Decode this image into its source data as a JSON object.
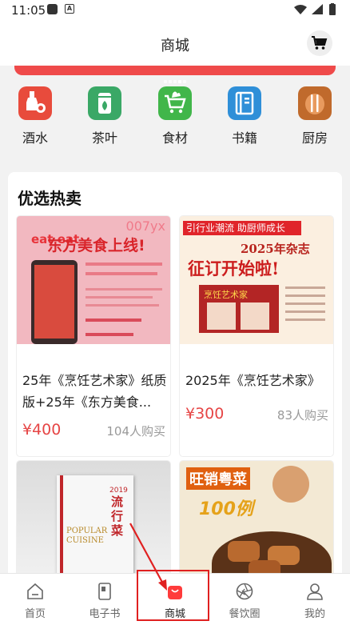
{
  "status_bar": {
    "time": "11:05",
    "notif_icon_letter": "A"
  },
  "header": {
    "title": "商城"
  },
  "categories": [
    {
      "label": "酒水",
      "icon": "wine-icon",
      "color": "#e84b3c"
    },
    {
      "label": "茶叶",
      "icon": "tea-icon",
      "color": "#3aa866"
    },
    {
      "label": "食材",
      "icon": "grocery-cart-icon",
      "color": "#41b64a"
    },
    {
      "label": "书籍",
      "icon": "book-icon",
      "color": "#2f8fd8"
    },
    {
      "label": "厨房",
      "icon": "kitchen-utensils-icon",
      "color": "#c06a2c"
    }
  ],
  "section": {
    "title": "优选热卖"
  },
  "products": [
    {
      "name": "25年《烹饪艺术家》纸质版+25年《东方美食...",
      "price": "¥400",
      "sold": "104人购买",
      "image": {
        "brand": "eat eat",
        "headline": "东方美食上线!",
        "tag": "007yx"
      }
    },
    {
      "name": "2025年《烹饪艺术家》",
      "price": "¥300",
      "sold": "83人购买",
      "image": {
        "top": "引行业潮流 助厨师成长",
        "year": "2025年杂志",
        "headline": "征订开始啦!",
        "magazine": "烹饪艺术家"
      }
    },
    {
      "image": {
        "headline": "流行菜",
        "subtitle": "POPULAR CUISINE",
        "year": "2019"
      }
    },
    {
      "image": {
        "headline": "旺销粤菜",
        "subtitle": "100例"
      }
    }
  ],
  "tabbar": [
    {
      "label": "首页",
      "icon": "home-icon"
    },
    {
      "label": "电子书",
      "icon": "ebook-icon"
    },
    {
      "label": "商城",
      "icon": "shopping-bag-icon",
      "active": true
    },
    {
      "label": "餐饮圈",
      "icon": "camera-aperture-icon"
    },
    {
      "label": "我的",
      "icon": "user-icon"
    }
  ],
  "colors": {
    "accent": "#e64545",
    "tab_active": "#ff3b3b",
    "highlight": "#e02020"
  }
}
